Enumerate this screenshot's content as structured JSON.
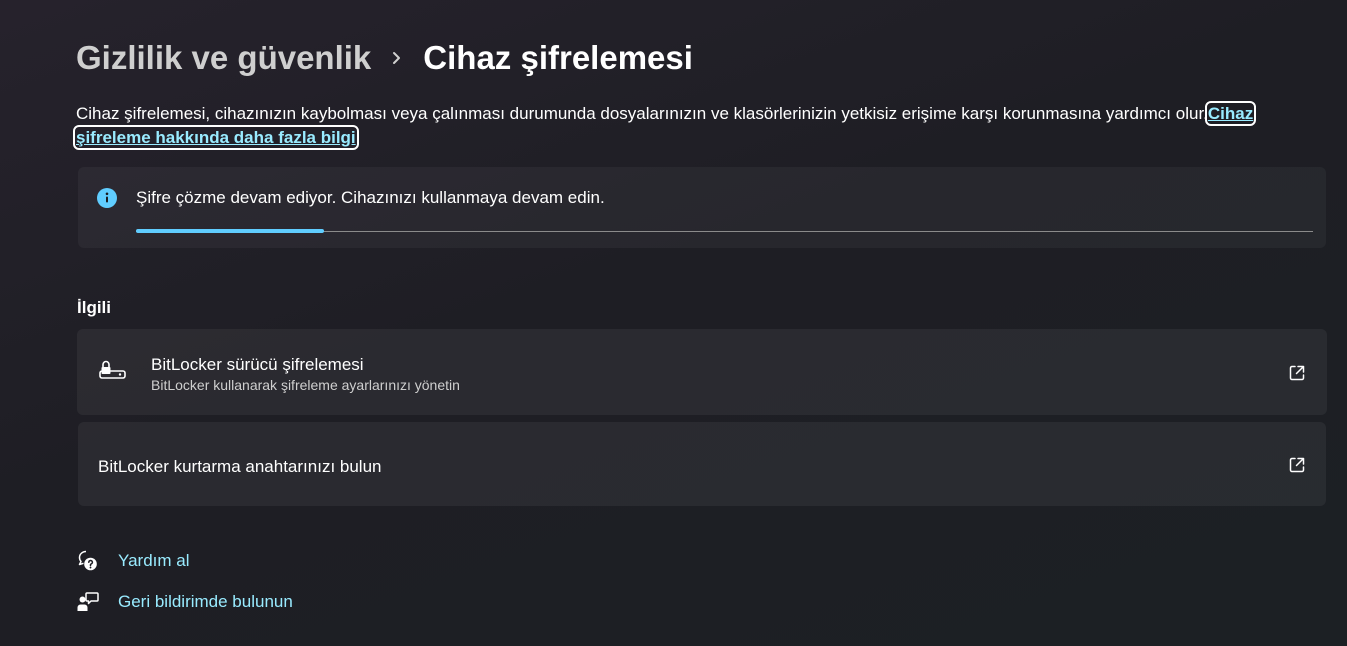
{
  "breadcrumb": {
    "parent": "Gizlilik ve güvenlik",
    "separator_icon": "chevron-right-icon",
    "current": "Cihaz şifrelemesi"
  },
  "description": {
    "text": "Cihaz şifrelemesi, cihazınızın kaybolması veya çalınması durumunda dosyalarınızın ve klasörlerinizin yetkisiz erişime karşı korunmasına yardımcı olur.",
    "link": "Cihaz şifreleme hakkında daha fazla bilgi"
  },
  "status": {
    "icon": "info-icon",
    "message": "Şifre çözme devam ediyor. Cihazınızı kullanmaya devam edin.",
    "progress_percent": 16
  },
  "related": {
    "title": "İlgili",
    "items": [
      {
        "icon": "lock-drive-icon",
        "title": "BitLocker sürücü şifrelemesi",
        "subtitle": "BitLocker kullanarak şifreleme ayarlarınızı yönetin",
        "action_icon": "open-external-icon"
      },
      {
        "title": "BitLocker kurtarma anahtarınızı bulun",
        "action_icon": "open-external-icon"
      }
    ]
  },
  "footer_links": [
    {
      "icon": "help-chat-icon",
      "label": "Yardım al"
    },
    {
      "icon": "feedback-person-icon",
      "label": "Geri bildirimde bulunun"
    }
  ],
  "colors": {
    "accent": "#60cdff",
    "link": "#99ebff",
    "background": "#202024"
  }
}
